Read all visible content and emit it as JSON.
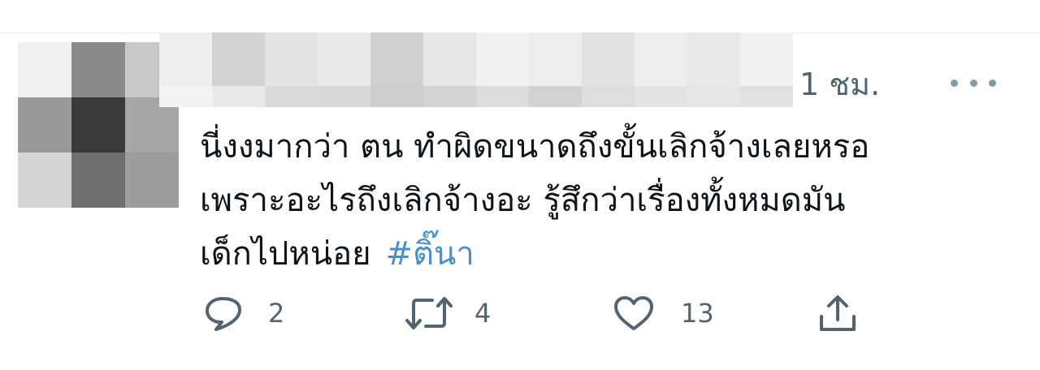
{
  "tweet": {
    "timestamp": "1 ชม.",
    "text_lines": [
      "นี่งงมากว่า ตน ทำผิดขนาดถึงขั้นเลิกจ้างเลยหรอ",
      "เพราะอะไรถึงเลิกจ้างอะ รู้สึกว่าเรื่องทั้งหมดมัน",
      "เด็กไปหน่อย"
    ],
    "hashtag": "#ติ๊นา"
  },
  "actions": {
    "reply_count": "2",
    "retweet_count": "4",
    "like_count": "13"
  },
  "icons": {
    "reply": "reply-icon",
    "retweet": "retweet-icon",
    "like": "heart-icon",
    "share": "share-icon",
    "more": "more-icon"
  },
  "colors": {
    "hashtag": "#4a90c9",
    "muted": "#536471",
    "text": "#0f1419"
  }
}
